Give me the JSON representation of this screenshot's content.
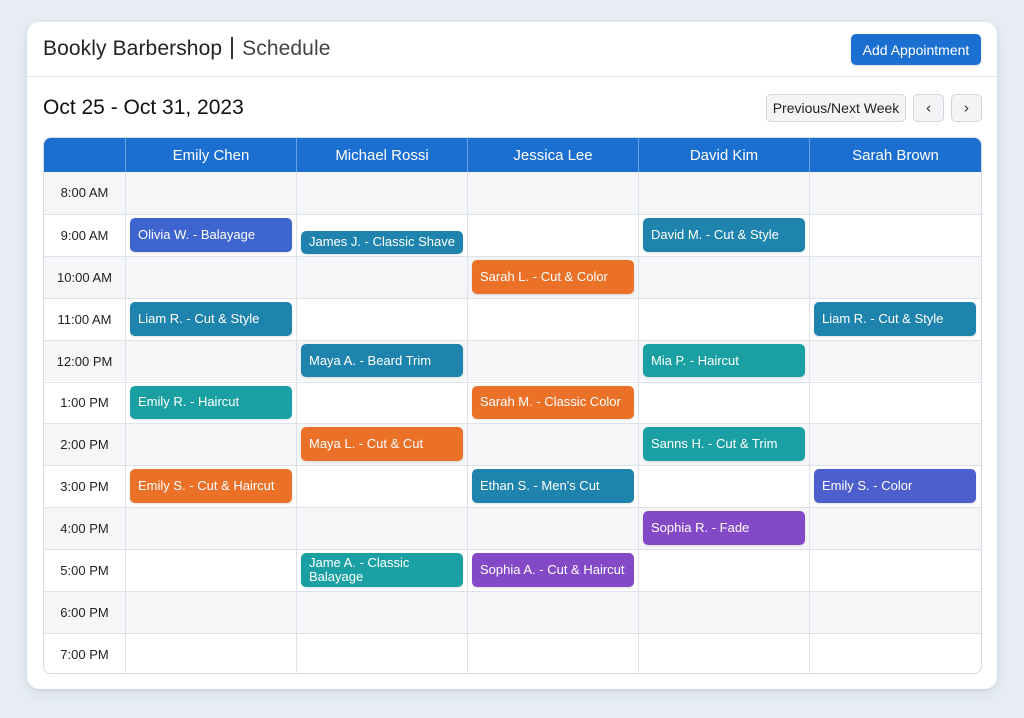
{
  "header": {
    "brand": "Bookly Barbershop",
    "subtitle": "Schedule",
    "add_button": "Add Appointment"
  },
  "toolbar": {
    "date_range": "Oct 25 - Oct 31, 2023",
    "week_button": "Previous/Next Week",
    "prev_icon": "chevron-left-icon",
    "next_icon": "chevron-right-icon"
  },
  "colors": {
    "primary": "#1a6fd1",
    "blue": "#3e65cf",
    "teal_blue": "#1f84ad",
    "teal": "#1aa0a3",
    "orange": "#ea7127",
    "purple": "#8449c7",
    "indigo": "#4d5fcc"
  },
  "staff": [
    "Emily Chen",
    "Michael Rossi",
    "Jessica Lee",
    "David Kim",
    "Sarah Brown"
  ],
  "times": [
    "8:00 AM",
    "9:00 AM",
    "10:00 AM",
    "11:00 AM",
    "12:00 PM",
    "1:00 PM",
    "2:00 PM",
    "3:00 PM",
    "4:00 PM",
    "5:00 PM",
    "6:00 PM",
    "7:00 PM"
  ],
  "appointments": [
    {
      "label": "Olivia W. - Balayage",
      "col": 0,
      "row": 1,
      "color": "#3e65cf"
    },
    {
      "label": "James J. - Classic Shave",
      "col": 1,
      "row": 1,
      "color": "#1f84ad",
      "offset": "half"
    },
    {
      "label": "David M. - Cut & Style",
      "col": 3,
      "row": 1,
      "color": "#1f84ad"
    },
    {
      "label": "Sarah L. - Cut & Color",
      "col": 2,
      "row": 2,
      "color": "#ea7127"
    },
    {
      "label": "Liam R. - Cut & Style",
      "col": 0,
      "row": 3,
      "color": "#1f84ad"
    },
    {
      "label": "Liam R. - Cut & Style",
      "col": 4,
      "row": 3,
      "color": "#1f84ad"
    },
    {
      "label": "Maya A. - Beard Trim",
      "col": 1,
      "row": 4,
      "color": "#1f84ad"
    },
    {
      "label": "Mia P. - Haircut",
      "col": 3,
      "row": 4,
      "color": "#1aa0a3"
    },
    {
      "label": "Emily R. - Haircut",
      "col": 0,
      "row": 5,
      "color": "#1aa0a3"
    },
    {
      "label": "Sarah M. - Classic Color",
      "col": 2,
      "row": 5,
      "color": "#ea7127"
    },
    {
      "label": "Maya L. - Cut & Cut",
      "col": 1,
      "row": 6,
      "color": "#ea7127"
    },
    {
      "label": "Sanns H. - Cut & Trim",
      "col": 3,
      "row": 6,
      "color": "#1aa0a3"
    },
    {
      "label": "Emily S. - Cut & Haircut",
      "col": 0,
      "row": 7,
      "color": "#ea7127"
    },
    {
      "label": "Ethan S. - Men's Cut",
      "col": 2,
      "row": 7,
      "color": "#1f84ad"
    },
    {
      "label": "Emily S. - Color",
      "col": 4,
      "row": 7,
      "color": "#4d5fcc"
    },
    {
      "label": "Sophia R. - Fade",
      "col": 3,
      "row": 8,
      "color": "#8449c7"
    },
    {
      "label": "Jame A. - Classic Balayage",
      "col": 1,
      "row": 9,
      "color": "#1aa0a3"
    },
    {
      "label": "Sophia A. - Cut & Haircut",
      "col": 2,
      "row": 9,
      "color": "#8449c7"
    }
  ]
}
